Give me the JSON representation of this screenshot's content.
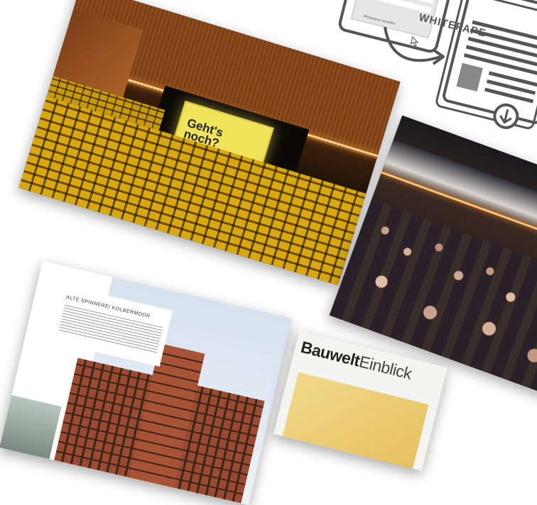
{
  "whitepaper": {
    "label": "WHITEPAPE",
    "order_button": "Whitepaper bestellen",
    "icon": "whitepaper-download-icon"
  },
  "auditorium_photo": {
    "screen_brand": "",
    "screen_title": "Geht's noch?"
  },
  "brochure": {
    "title": "ALTE SPINNEREI KOLBERMOOR"
  },
  "magazine": {
    "brand": "Bauwelt",
    "sub": "Einblick"
  },
  "colors": {
    "accent_yellow": "#f0e35a",
    "seat_yellow": "#d9a810",
    "wood_brown": "#8a4a1c",
    "icon_gray": "#555555"
  }
}
